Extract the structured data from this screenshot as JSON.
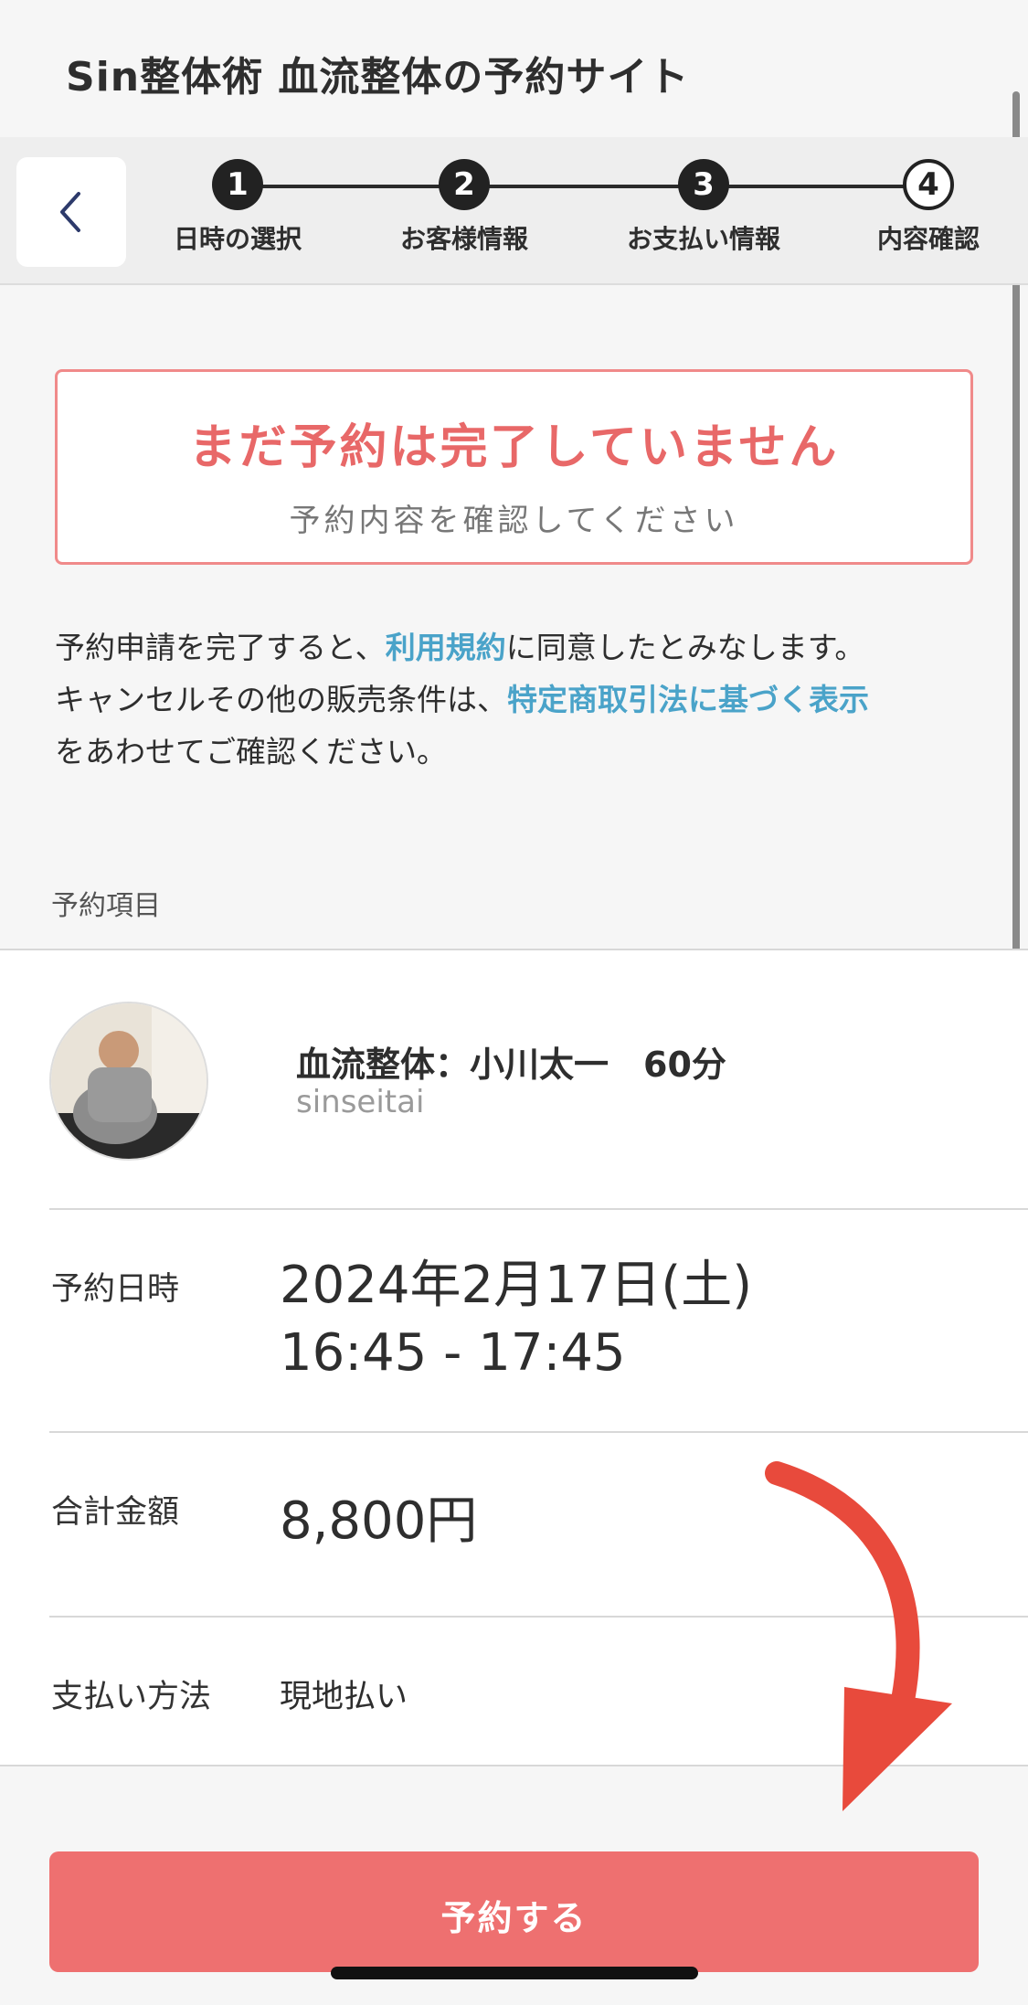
{
  "header": {
    "title": "Sin整体術 血流整体の予約サイト"
  },
  "steps": [
    {
      "number": "1",
      "label": "日時の選択"
    },
    {
      "number": "2",
      "label": "お客様情報"
    },
    {
      "number": "3",
      "label": "お支払い情報"
    },
    {
      "number": "4",
      "label": "内容確認"
    }
  ],
  "notice": {
    "title": "まだ予約は完了していません",
    "subtitle": "予約内容を確認してください"
  },
  "terms": {
    "line1_pre": "予約申請を完了すると、",
    "terms_link": "利用規約",
    "line1_post": "に同意したとみなします。",
    "line2_pre": "キャンセルその他の販売条件は、",
    "law_link": "特定商取引法に基づく表示",
    "line3": "をあわせてご確認ください。"
  },
  "section": {
    "label": "予約項目"
  },
  "item": {
    "name": "血流整体：小川太一　60分",
    "shop": "sinseitai"
  },
  "details": {
    "datetime_label": "予約日時",
    "date": "2024年2月17日(土)",
    "time": "16:45 - 17:45",
    "total_label": "合計金額",
    "total": "8,800円",
    "payment_label": "支払い方法",
    "payment": "現地払い"
  },
  "cta": {
    "label": "予約する"
  },
  "colors": {
    "accent": "#ee7070",
    "link": "#4aa3c9",
    "notice_border": "#f08a8a",
    "annotation_arrow": "#e84a3c"
  },
  "icons": {
    "back": "chevron-left-icon"
  }
}
